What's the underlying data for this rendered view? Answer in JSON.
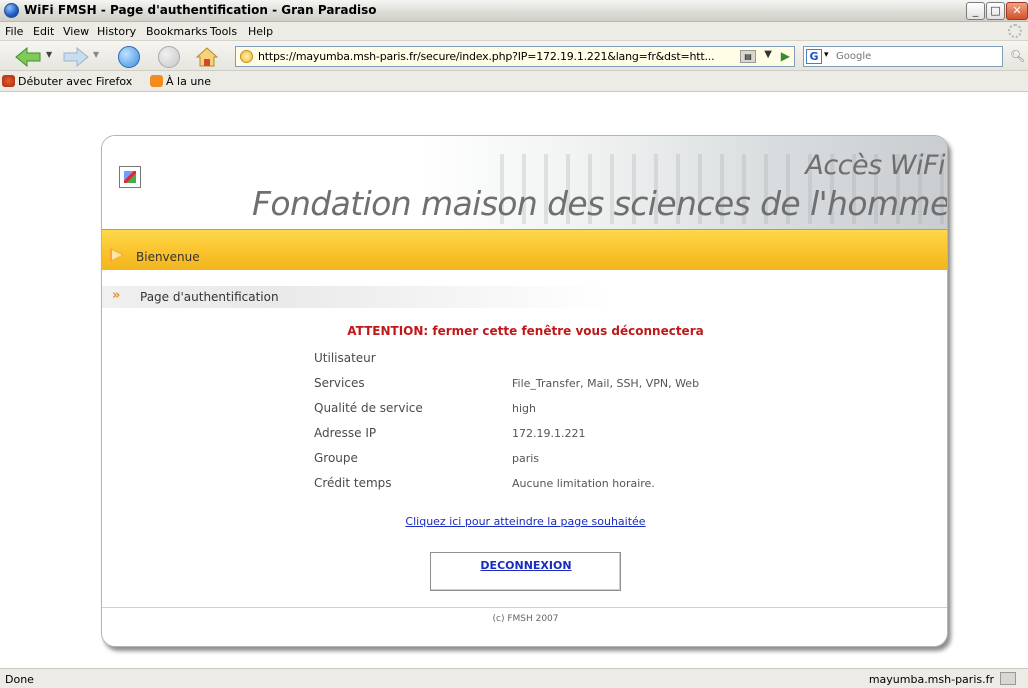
{
  "window": {
    "title": "WiFi FMSH - Page d'authentification - Gran Paradiso"
  },
  "menu": [
    "File",
    "Edit",
    "View",
    "History",
    "Bookmarks",
    "Tools",
    "Help"
  ],
  "nav": {
    "url": "https://mayumba.msh-paris.fr/secure/index.php?IP=172.19.1.221&lang=fr&dst=htt...",
    "search_placeholder": "Google"
  },
  "bookmarks": [
    "Débuter avec Firefox",
    "À la une"
  ],
  "page": {
    "header_top": "Accès WiFi",
    "header_main": "Fondation maison des sciences de l'homme",
    "section1": "Bienvenue",
    "section2": "Page d'authentification",
    "attention": "ATTENTION: fermer cette fenêtre vous déconnectera",
    "rows": [
      {
        "label": "Utilisateur",
        "value": ""
      },
      {
        "label": "Services",
        "value": "File_Transfer, Mail, SSH, VPN, Web"
      },
      {
        "label": "Qualité de service",
        "value": "high"
      },
      {
        "label": "Adresse IP",
        "value": "172.19.1.221"
      },
      {
        "label": "Groupe",
        "value": "paris"
      },
      {
        "label": "Crédit temps",
        "value": "Aucune limitation horaire."
      }
    ],
    "link": "Cliquez ici pour atteindre la page souhaitée",
    "logout": "DECONNEXION",
    "copyright": "(c) FMSH 2007"
  },
  "status": {
    "left": "Done",
    "right": "mayumba.msh-paris.fr"
  },
  "colors": {
    "accent_yellow": "#f9c12b",
    "attention_red": "#c0181a",
    "link_blue": "#1a2bc0"
  }
}
